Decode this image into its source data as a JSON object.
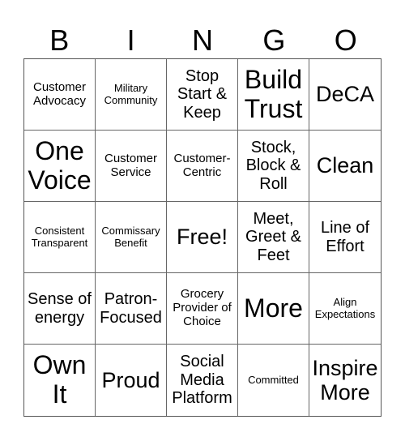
{
  "header": {
    "letters": [
      "B",
      "I",
      "N",
      "G",
      "O"
    ]
  },
  "cells": [
    {
      "text": "Customer Advocacy",
      "size": "s-sm"
    },
    {
      "text": "Military Community",
      "size": "s-xs"
    },
    {
      "text": "Stop Start & Keep",
      "size": "s-md"
    },
    {
      "text": "Build Trust",
      "size": "s-xl"
    },
    {
      "text": "DeCA",
      "size": "s-lg"
    },
    {
      "text": "One Voice",
      "size": "s-xl"
    },
    {
      "text": "Customer Service",
      "size": "s-sm"
    },
    {
      "text": "Customer-Centric",
      "size": "s-sm"
    },
    {
      "text": "Stock, Block & Roll",
      "size": "s-md"
    },
    {
      "text": "Clean",
      "size": "s-lg"
    },
    {
      "text": "Consistent Transparent",
      "size": "s-xs"
    },
    {
      "text": "Commissary Benefit",
      "size": "s-xs"
    },
    {
      "text": "Free!",
      "size": "s-lg"
    },
    {
      "text": "Meet, Greet & Feet",
      "size": "s-md"
    },
    {
      "text": "Line of Effort",
      "size": "s-md"
    },
    {
      "text": "Sense of energy",
      "size": "s-md"
    },
    {
      "text": "Patron-Focused",
      "size": "s-md"
    },
    {
      "text": "Grocery Provider of Choice",
      "size": "s-sm"
    },
    {
      "text": "More",
      "size": "s-xl"
    },
    {
      "text": "Align Expectations",
      "size": "s-xs"
    },
    {
      "text": "Own It",
      "size": "s-xl"
    },
    {
      "text": "Proud",
      "size": "s-lg"
    },
    {
      "text": "Social Media Platform",
      "size": "s-md"
    },
    {
      "text": "Committed",
      "size": "s-xs"
    },
    {
      "text": "Inspire More",
      "size": "s-lg"
    }
  ]
}
